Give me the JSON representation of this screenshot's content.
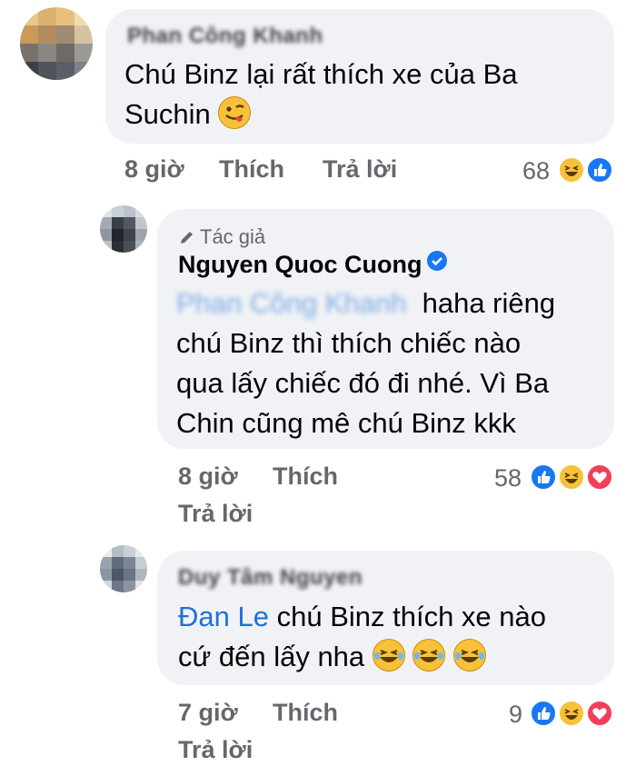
{
  "comments": [
    {
      "author": "Phan Công Khanh",
      "text": "Chú Binz lại rất thích xe của Ba",
      "text_line2": "Suchin",
      "emoji": "winking-tongue-emoji",
      "time": "8 giờ",
      "like_label": "Thích",
      "reply_label": "Trả lời",
      "reaction_count": "68",
      "reactions": [
        "haha-icon",
        "like-icon"
      ]
    },
    {
      "badge": "Tác giả",
      "author": "Nguyen Quoc Cuong",
      "mention": "Phan Công Khanh",
      "text_line1": "haha riêng",
      "text_line2": "chú Binz thì thích chiếc nào",
      "text_line3": "qua lấy chiếc đó đi nhé. Vì Ba",
      "text_line4": "Chin cũng mê chú Binz kkk",
      "time": "8 giờ",
      "like_label": "Thích",
      "reply_label": "Trả lời",
      "reaction_count": "58",
      "reactions": [
        "like-icon",
        "haha-icon",
        "love-icon"
      ]
    },
    {
      "author": "Duy Tâm Nguyen",
      "mention": "Đan Le",
      "text_line1": "chú Binz thích xe nào",
      "text_line2": "cứ đến lấy nha",
      "emoji": "laughing-tears-emoji",
      "time": "7 giờ",
      "like_label": "Thích",
      "reply_label": "Trả lời",
      "reaction_count": "9",
      "reactions": [
        "like-icon",
        "haha-icon",
        "love-icon"
      ]
    }
  ]
}
